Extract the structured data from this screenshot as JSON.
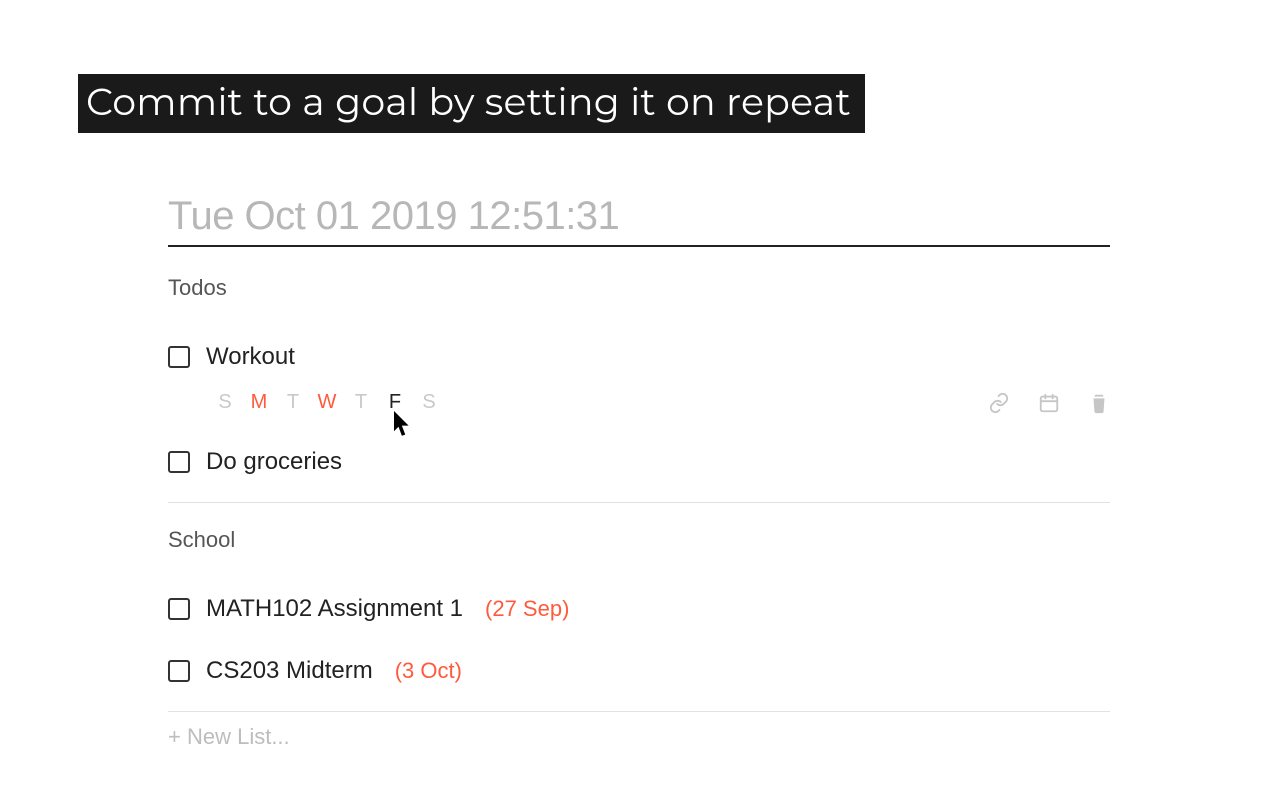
{
  "banner": "Commit to a goal by setting it on repeat",
  "date_heading": "Tue Oct 01 2019 12:51:31",
  "lists": [
    {
      "title": "Todos",
      "tasks": [
        {
          "label": "Workout",
          "due": null,
          "repeat_days": [
            {
              "abbr": "S",
              "active": false,
              "hover": false
            },
            {
              "abbr": "M",
              "active": true,
              "hover": false
            },
            {
              "abbr": "T",
              "active": false,
              "hover": false
            },
            {
              "abbr": "W",
              "active": true,
              "hover": false
            },
            {
              "abbr": "T",
              "active": false,
              "hover": false
            },
            {
              "abbr": "F",
              "active": false,
              "hover": true
            },
            {
              "abbr": "S",
              "active": false,
              "hover": false
            }
          ],
          "show_actions": true
        },
        {
          "label": "Do groceries",
          "due": null
        }
      ]
    },
    {
      "title": "School",
      "tasks": [
        {
          "label": "MATH102 Assignment 1",
          "due": "(27 Sep)"
        },
        {
          "label": "CS203 Midterm",
          "due": "(3 Oct)"
        }
      ]
    }
  ],
  "new_list_placeholder": "+ New List..."
}
